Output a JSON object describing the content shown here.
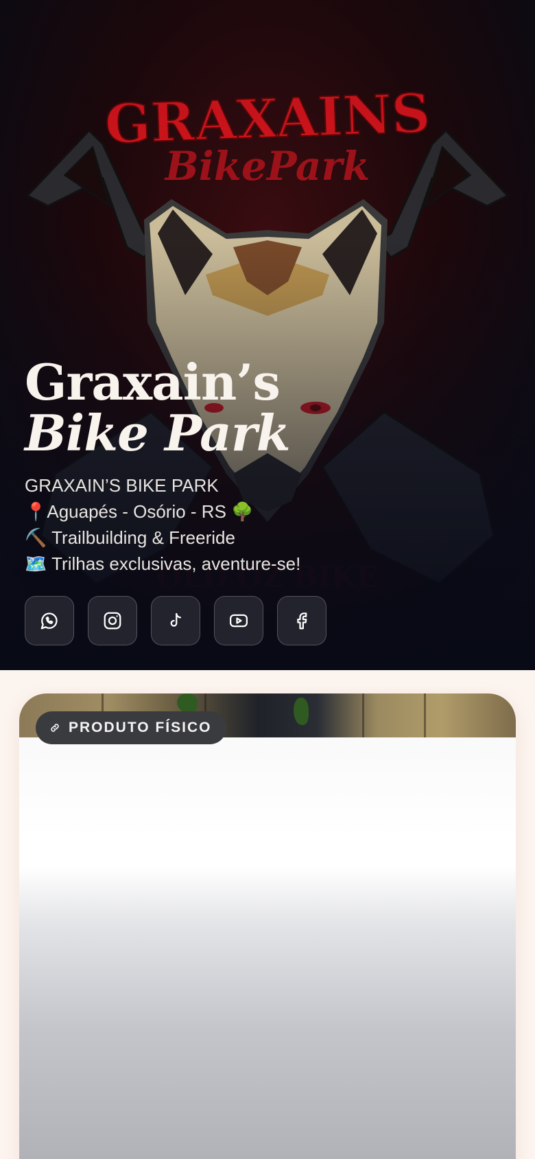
{
  "hero": {
    "logo_text_top": "GRAXAINS",
    "logo_text_bottom": "BikePark",
    "title_line1": "Graxain’s",
    "title_line2": "Bike Park",
    "bio": [
      "GRAXAIN’S BIKE PARK",
      "📍Aguapés - Osório - RS 🌳",
      "⛏️ Trailbuilding & Freeride",
      "🗺️ Trilhas exclusivas, aventure-se!"
    ]
  },
  "socials": [
    {
      "icon": "whatsapp-icon"
    },
    {
      "icon": "instagram-icon"
    },
    {
      "icon": "tiktok-icon"
    },
    {
      "icon": "youtube-icon"
    },
    {
      "icon": "facebook-icon"
    }
  ],
  "card": {
    "badge_label": "PRODUTO FÍSICO",
    "badge_icon": "link-icon"
  },
  "colors": {
    "logo_red": "#d6141c",
    "page_bg": "#fcf4ef",
    "badge_bg": "#3a3b3f"
  }
}
